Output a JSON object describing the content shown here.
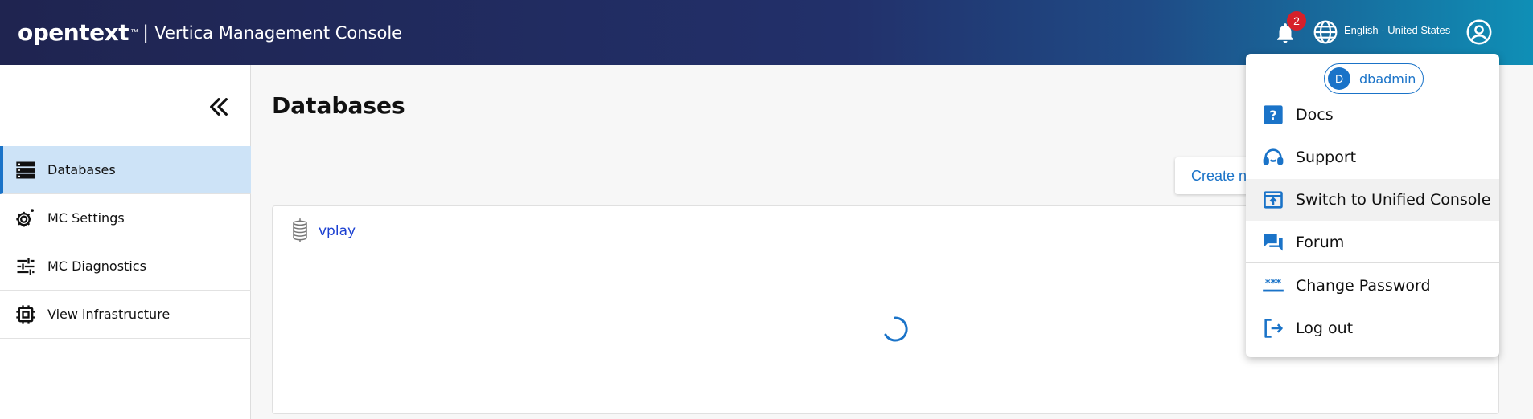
{
  "header": {
    "logo": "opentext",
    "logo_tm": "™",
    "separator": "|",
    "product_title": "Vertica Management Console",
    "notification_count": "2",
    "language": "English - United States"
  },
  "sidebar": {
    "items": [
      {
        "label": "Databases",
        "icon": "database-stack-icon",
        "active": true
      },
      {
        "label": "MC Settings",
        "icon": "gear-settings-icon",
        "active": false
      },
      {
        "label": "MC Diagnostics",
        "icon": "sliders-icon",
        "active": false
      },
      {
        "label": "View infrastructure",
        "icon": "chip-icon",
        "active": false
      }
    ]
  },
  "main": {
    "title": "Databases",
    "create_button": "Create new database",
    "database": {
      "name": "vplay"
    }
  },
  "user_menu": {
    "avatar_letter": "D",
    "username": "dbadmin",
    "items": [
      {
        "label": "Docs",
        "icon": "help-icon"
      },
      {
        "label": "Support",
        "icon": "headset-icon"
      },
      {
        "label": "Switch to Unified Console",
        "icon": "switch-console-icon"
      },
      {
        "label": "Forum",
        "icon": "forum-icon"
      },
      {
        "label": "Change Password",
        "icon": "password-icon"
      },
      {
        "label": "Log out",
        "icon": "logout-icon"
      }
    ]
  },
  "colors": {
    "accent": "#1a73c8",
    "header_start": "#1f2450",
    "header_end": "#0f8fb6",
    "badge": "#d6202a",
    "active_nav_bg": "#cde3f7"
  }
}
